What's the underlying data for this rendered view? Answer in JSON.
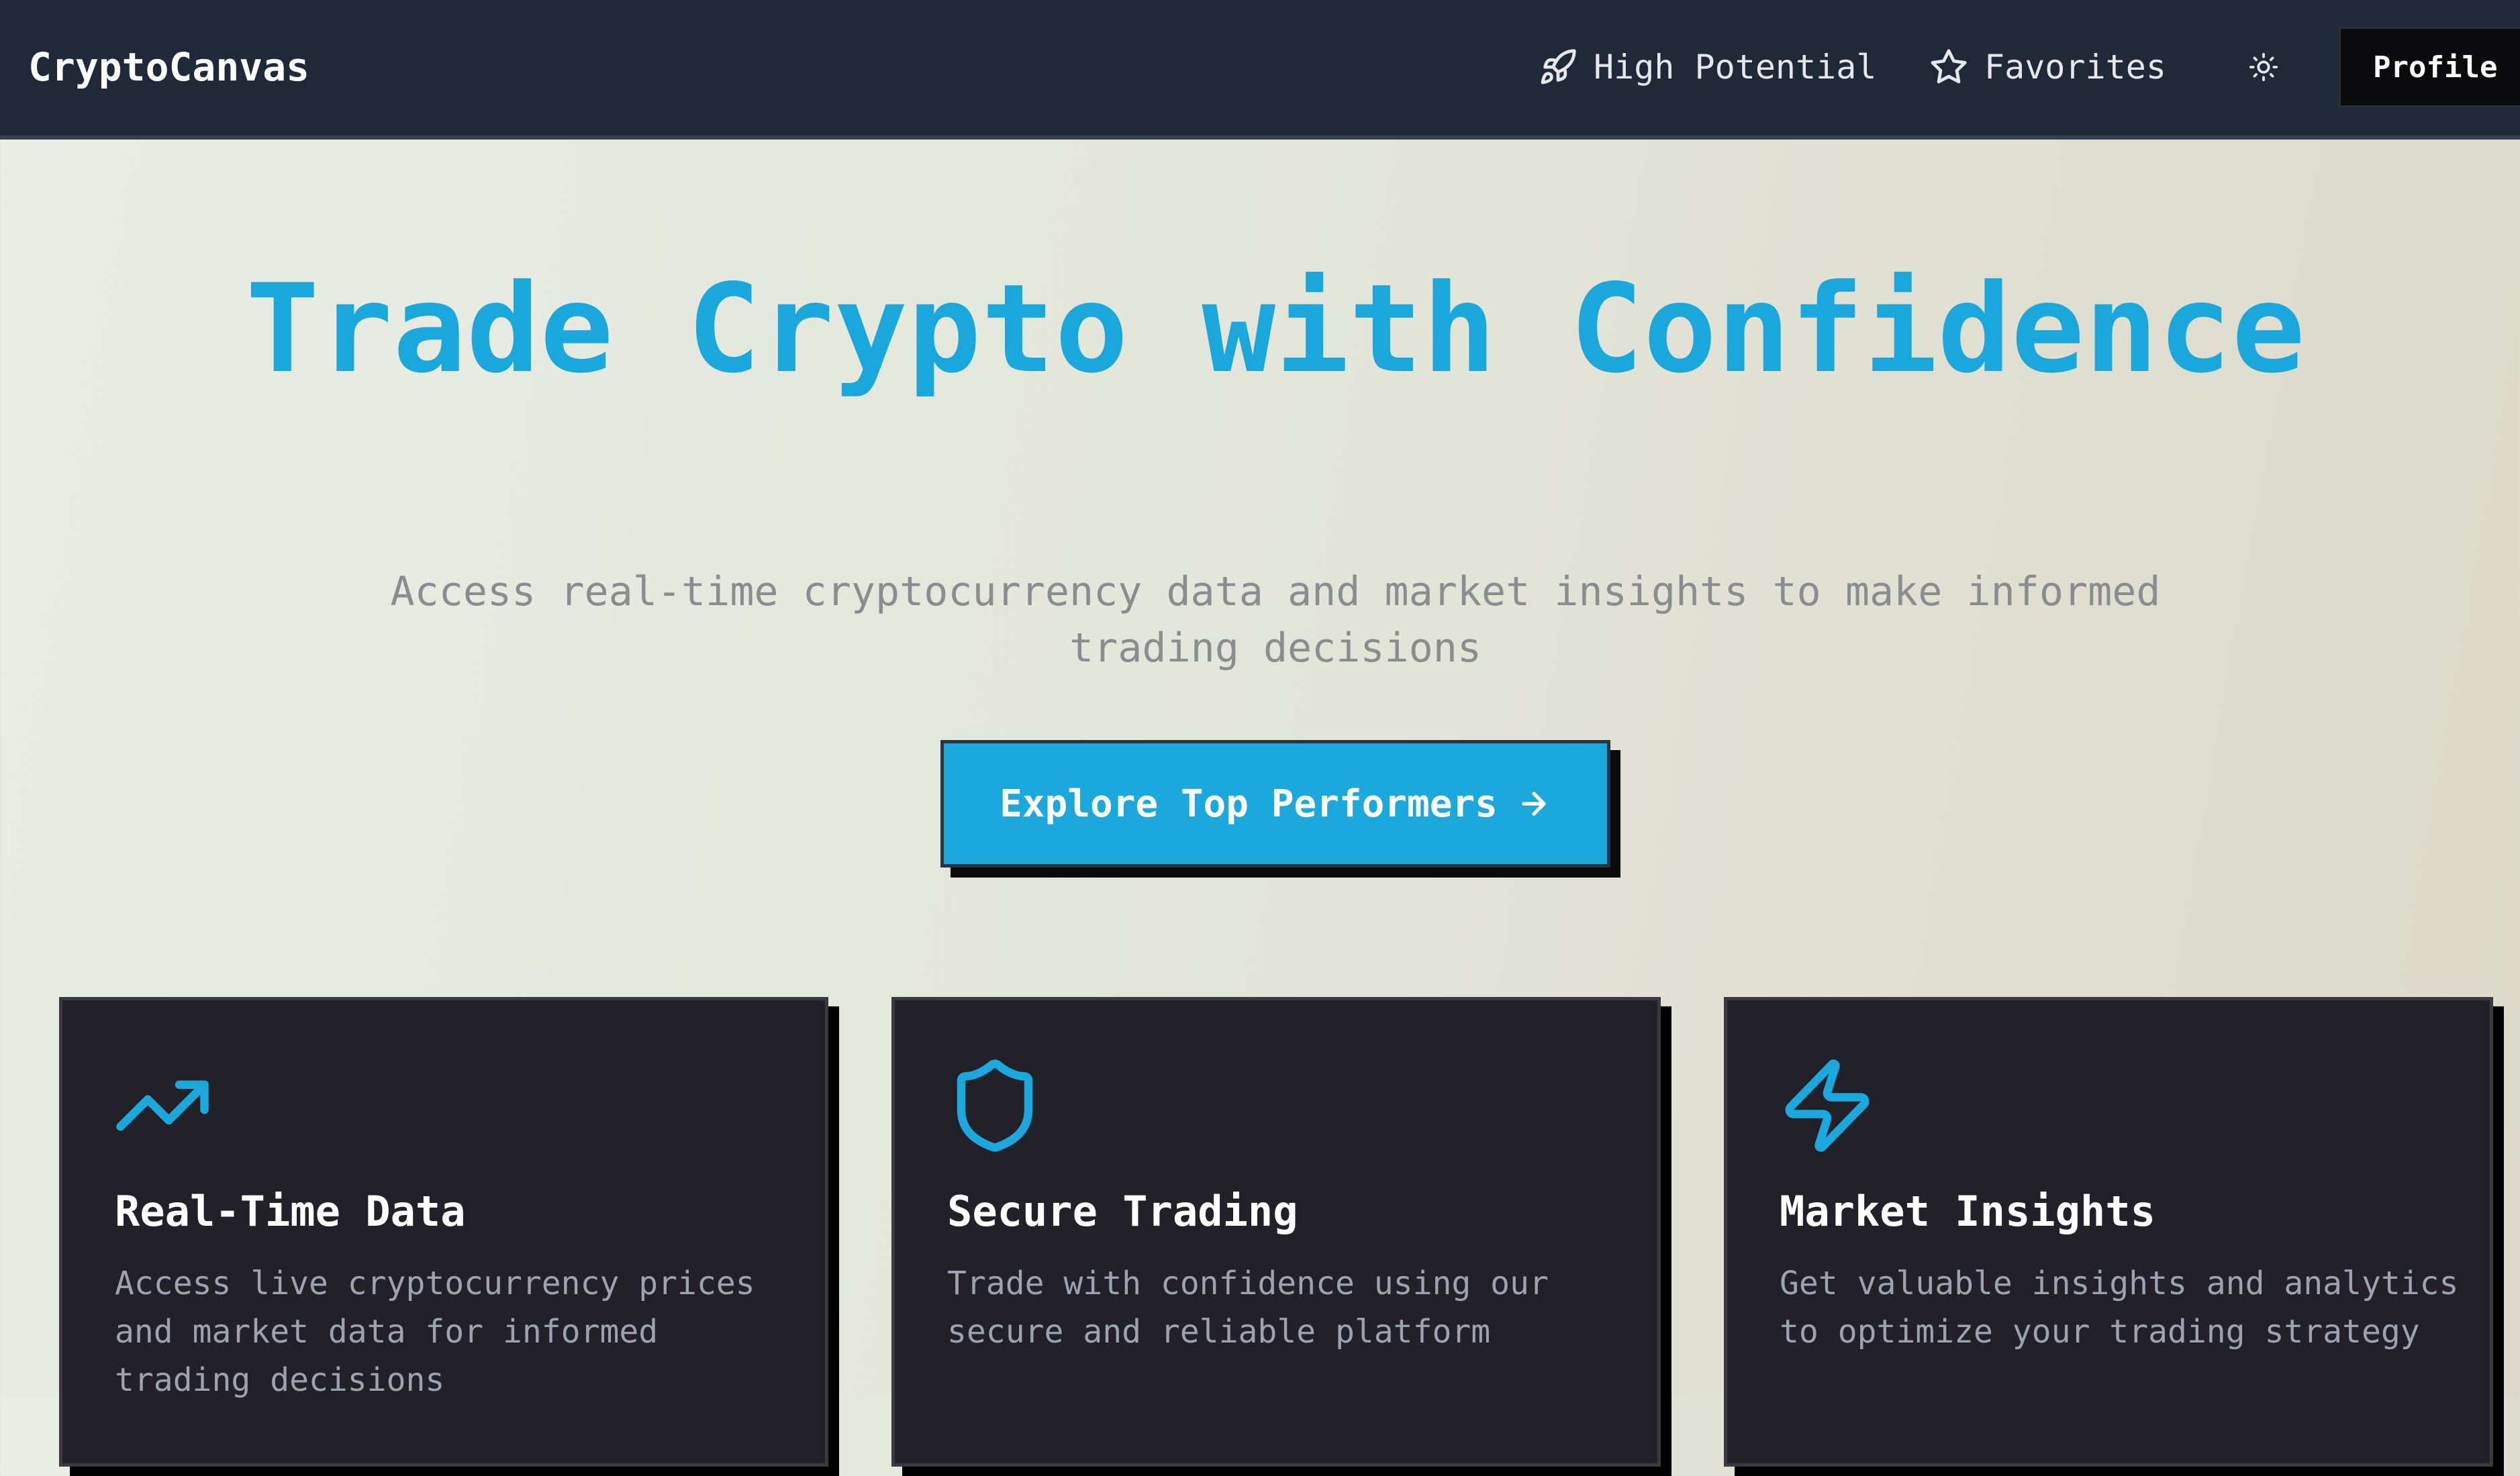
{
  "header": {
    "brand": "CryptoCanvas",
    "nav": [
      {
        "label": "High Potential",
        "icon": "rocket-icon"
      },
      {
        "label": "Favorites",
        "icon": "star-icon"
      }
    ],
    "theme_toggle_icon": "sun-icon",
    "profile_label": "Profile"
  },
  "hero": {
    "title": "Trade Crypto with Confidence",
    "subtitle": "Access real-time cryptocurrency data and market insights to make informed trading decisions",
    "cta_label": "Explore Top Performers",
    "cta_icon": "arrow-right-icon"
  },
  "features": [
    {
      "icon": "trending-up-icon",
      "title": "Real-Time Data",
      "description": "Access live cryptocurrency prices and market data for informed trading decisions"
    },
    {
      "icon": "shield-icon",
      "title": "Secure Trading",
      "description": "Trade with confidence using our secure and reliable platform"
    },
    {
      "icon": "zap-icon",
      "title": "Market Insights",
      "description": "Get valuable insights and analytics to optimize your trading strategy"
    }
  ],
  "colors": {
    "accent": "#1ba8dc",
    "header_bg": "#1f2937",
    "card_bg": "#222028",
    "button_dark": "#0b0b0d"
  }
}
